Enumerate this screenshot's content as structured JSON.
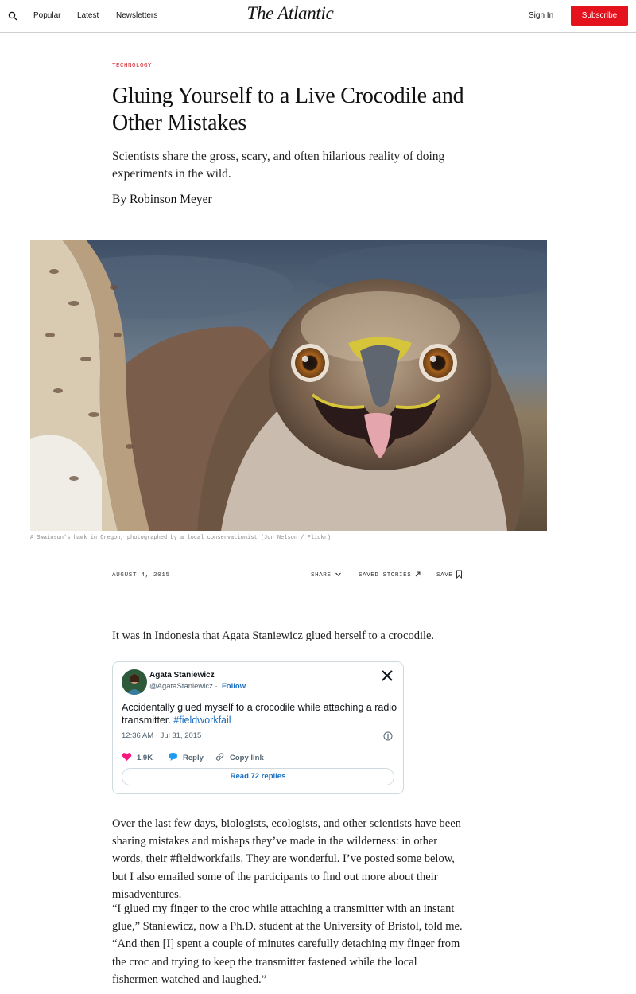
{
  "header": {
    "nav": [
      "Popular",
      "Latest",
      "Newsletters"
    ],
    "logo": "The Atlantic",
    "sign_in": "Sign In",
    "subscribe": "Subscribe",
    "subscribe_color": "#e4121d",
    "search_icon": "search-icon"
  },
  "article": {
    "section": "Technology",
    "title": "Gluing Yourself to a Live Crocodile and Other Mistakes",
    "dek": "Scientists share the gross, scary, and often hilarious reality of doing experiments in the wild.",
    "byline": "By Robinson Meyer",
    "caption": "A Swainson's hawk in Oregon, photographed by a local conservationist (Jon Nelson / Flickr)",
    "date": "August 4, 2015",
    "actions": {
      "share": "Share",
      "saved_stories": "Saved Stories",
      "save": "Save"
    },
    "paragraphs": [
      "It was in Indonesia that Agata Staniewicz glued herself to a crocodile.",
      "Over the last few days, biologists, ecologists, and other scientists have been sharing mistakes and mishaps they’ve made in the wilderness: in other words, their #fieldworkfails. They are wonderful. I’ve posted some below, but I also emailed some of the participants to find out more about their misadventures.",
      "“I glued my finger to the croc while attaching a transmitter with an instant glue,” Staniewicz, now a Ph.D. student at the University of Bristol, told me. “And then [I] spent a couple of minutes carefully detaching my finger from the croc and trying to keep the transmitter fastened while the local fishermen watched and laughed.”"
    ]
  },
  "embed": {
    "name": "Agata Staniewicz",
    "handle": "@AgataStaniewicz",
    "separator": "·",
    "follow": "Follow",
    "text": "Accidentally glued myself to a crocodile while attaching a radio transmitter. ",
    "hashtag": "#fieldworkfail",
    "timestamp": "12:36 AM · Jul 31, 2015",
    "likes": "1.9K",
    "reply": "Reply",
    "copy_link": "Copy link",
    "read_replies": "Read 72 replies",
    "like_color": "#f91880",
    "link_color": "#1d6fbf"
  }
}
